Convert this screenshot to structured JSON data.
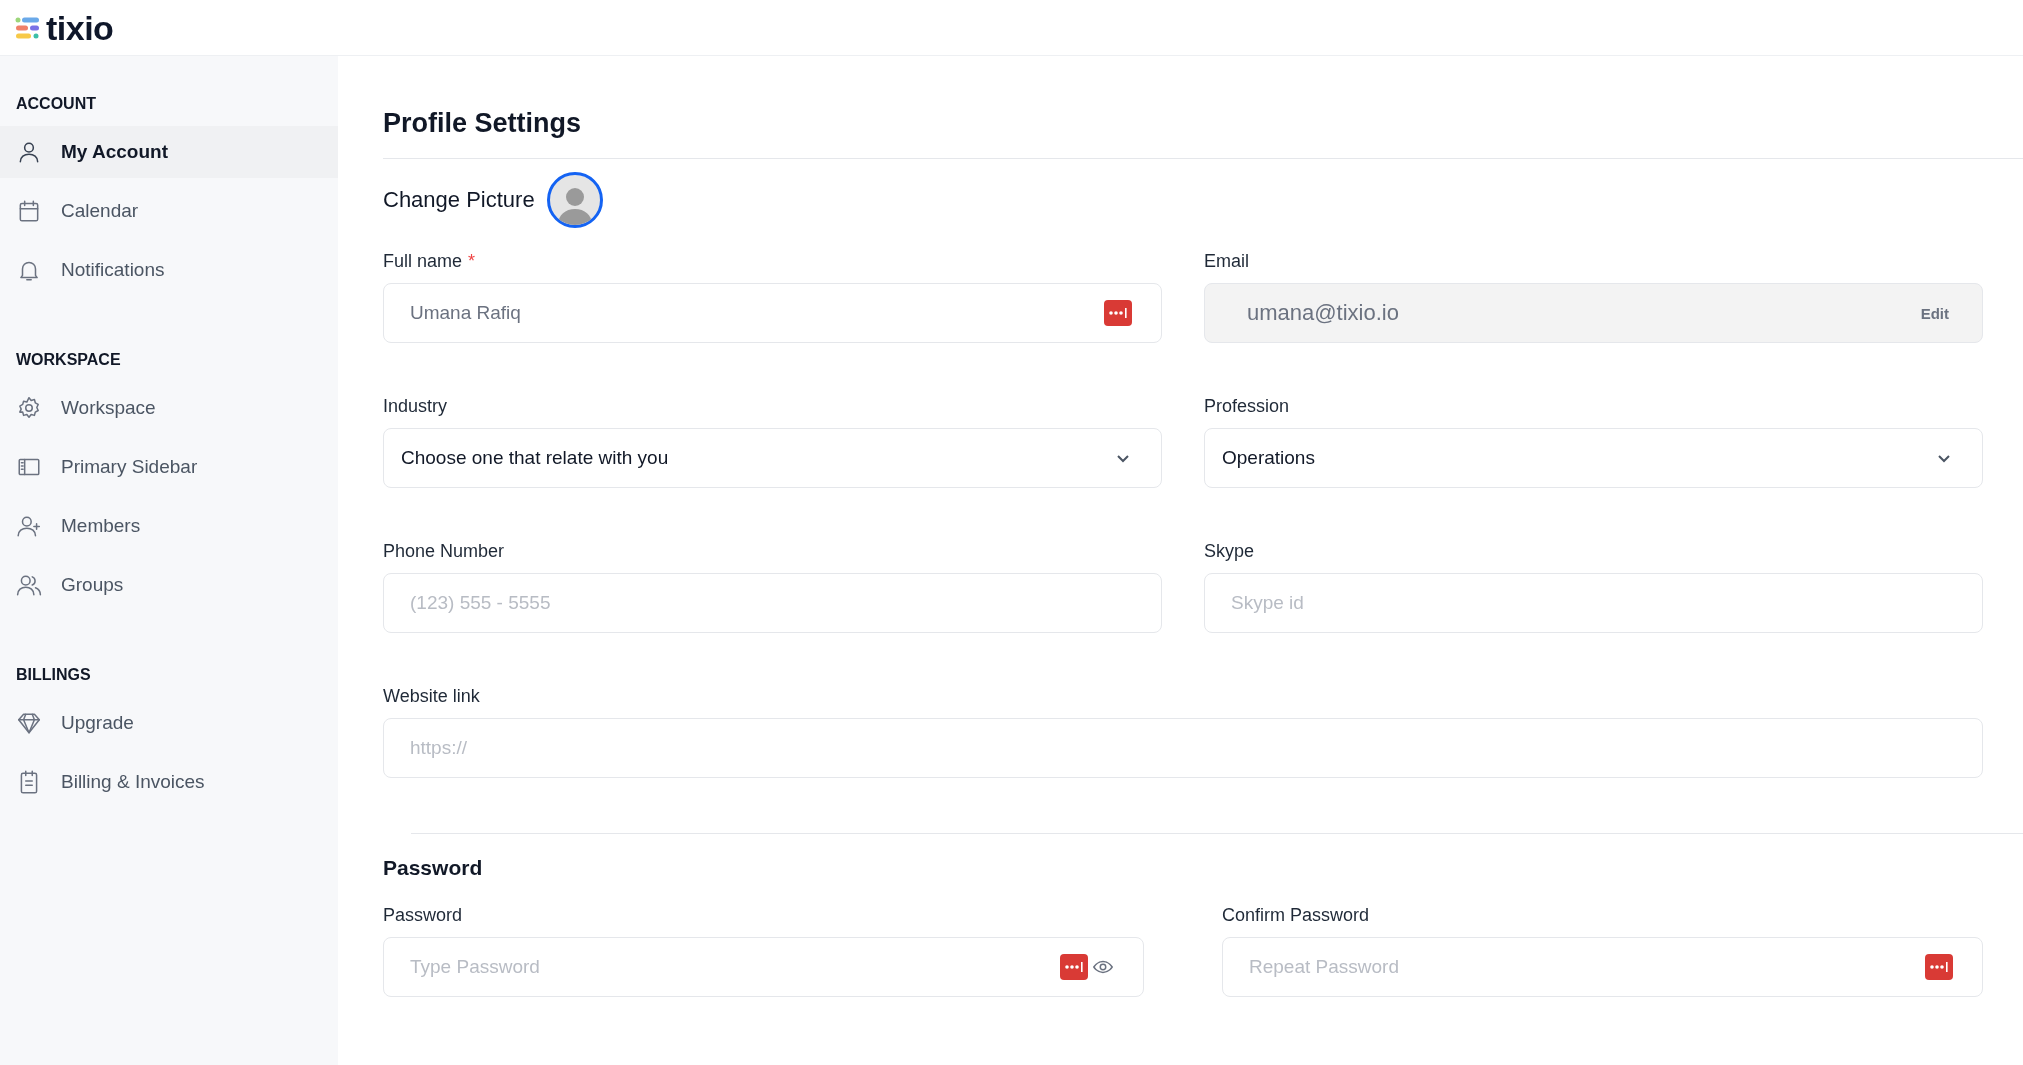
{
  "logo": {
    "text": "tixio"
  },
  "sidebar": {
    "sections": [
      {
        "title": "ACCOUNT",
        "items": [
          {
            "label": "My Account",
            "selected": true
          },
          {
            "label": "Calendar",
            "selected": false
          },
          {
            "label": "Notifications",
            "selected": false
          }
        ]
      },
      {
        "title": "WORKSPACE",
        "items": [
          {
            "label": "Workspace",
            "selected": false
          },
          {
            "label": "Primary Sidebar",
            "selected": false
          },
          {
            "label": "Members",
            "selected": false
          },
          {
            "label": "Groups",
            "selected": false
          }
        ]
      },
      {
        "title": "BILLINGS",
        "items": [
          {
            "label": "Upgrade",
            "selected": false
          },
          {
            "label": "Billing & Invoices",
            "selected": false
          }
        ]
      }
    ]
  },
  "page_title": "Profile Settings",
  "change_picture": {
    "label": "Change Picture"
  },
  "profile_rows": [
    [
      {
        "kind": "text",
        "label": "Full name",
        "required_mark": "*",
        "value": "Umana Rafiq",
        "autofill": true
      },
      {
        "kind": "locked",
        "label": "Email",
        "value": "umana@tixio.io",
        "action": "Edit"
      }
    ],
    [
      {
        "kind": "select",
        "label": "Industry",
        "value": "Choose one that relate with you"
      },
      {
        "kind": "select",
        "label": "Profession",
        "value": "Operations"
      }
    ],
    [
      {
        "kind": "text",
        "label": "Phone Number",
        "placeholder": "(123) 555 - 5555"
      },
      {
        "kind": "text",
        "label": "Skype",
        "placeholder": "Skype id"
      }
    ],
    [
      {
        "kind": "text",
        "label": "Website link",
        "placeholder": "https://"
      }
    ]
  ],
  "password_section": {
    "title": "Password",
    "rows": [
      [
        {
          "kind": "password",
          "label": "Password",
          "placeholder": "Type Password",
          "autofill": true,
          "reveal": true
        },
        {
          "kind": "password",
          "label": "Confirm Password",
          "placeholder": "Repeat Password",
          "autofill": true
        }
      ]
    ]
  }
}
